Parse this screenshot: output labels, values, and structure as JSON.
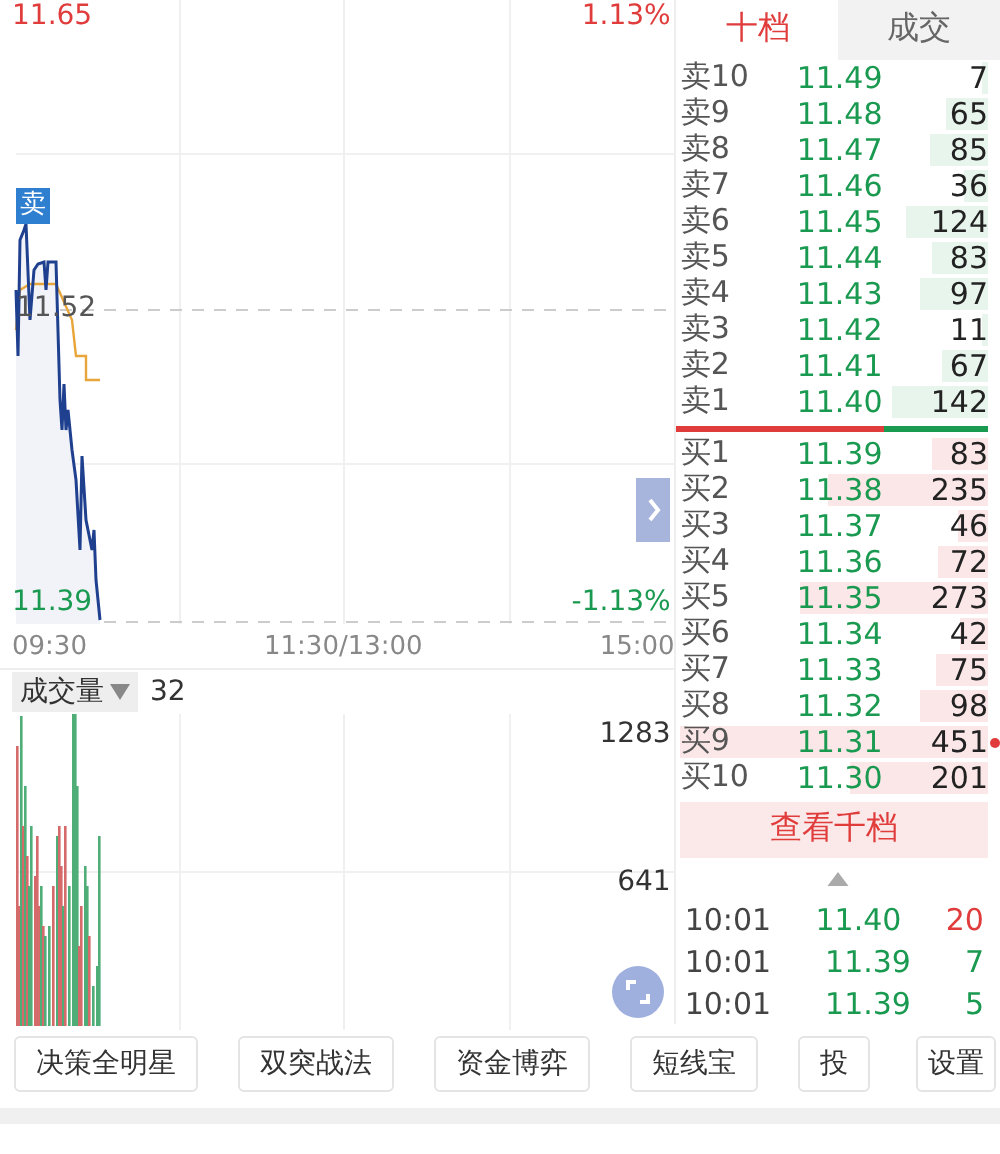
{
  "price_chart": {
    "high": "11.65",
    "high_pct": "1.13%",
    "mid": "11.52",
    "low": "11.39",
    "low_pct": "-1.13%",
    "signal_badge": "卖",
    "times": [
      "09:30",
      "11:30/13:00",
      "15:00"
    ]
  },
  "volume_chart": {
    "indicator": "成交量",
    "value": "32",
    "axis_labels": [
      "1283",
      "641"
    ]
  },
  "tabs": [
    {
      "label": "十档",
      "selected": true
    },
    {
      "label": "成交",
      "selected": false
    }
  ],
  "asks": [
    {
      "label": "卖10",
      "price": "11.49",
      "volume": "7",
      "level": 0.02
    },
    {
      "label": "卖9",
      "price": "11.48",
      "volume": "65",
      "level": 0.14
    },
    {
      "label": "卖8",
      "price": "11.47",
      "volume": "85",
      "level": 0.19
    },
    {
      "label": "卖7",
      "price": "11.46",
      "volume": "36",
      "level": 0.08
    },
    {
      "label": "卖6",
      "price": "11.45",
      "volume": "124",
      "level": 0.27
    },
    {
      "label": "卖5",
      "price": "11.44",
      "volume": "83",
      "level": 0.18
    },
    {
      "label": "卖4",
      "price": "11.43",
      "volume": "97",
      "level": 0.22
    },
    {
      "label": "卖3",
      "price": "11.42",
      "volume": "11",
      "level": 0.02
    },
    {
      "label": "卖2",
      "price": "11.41",
      "volume": "67",
      "level": 0.15
    },
    {
      "label": "卖1",
      "price": "11.40",
      "volume": "142",
      "level": 0.31
    }
  ],
  "bids": [
    {
      "label": "买1",
      "price": "11.39",
      "volume": "83",
      "level": 0.18,
      "marked": false
    },
    {
      "label": "买2",
      "price": "11.38",
      "volume": "235",
      "level": 0.52,
      "marked": false
    },
    {
      "label": "买3",
      "price": "11.37",
      "volume": "46",
      "level": 0.1,
      "marked": false
    },
    {
      "label": "买4",
      "price": "11.36",
      "volume": "72",
      "level": 0.16,
      "marked": false
    },
    {
      "label": "买5",
      "price": "11.35",
      "volume": "273",
      "level": 0.61,
      "marked": false
    },
    {
      "label": "买6",
      "price": "11.34",
      "volume": "42",
      "level": 0.09,
      "marked": false
    },
    {
      "label": "买7",
      "price": "11.33",
      "volume": "75",
      "level": 0.17,
      "marked": false
    },
    {
      "label": "买8",
      "price": "11.32",
      "volume": "98",
      "level": 0.22,
      "marked": false
    },
    {
      "label": "买9",
      "price": "11.31",
      "volume": "451",
      "level": 1,
      "marked": true
    },
    {
      "label": "买10",
      "price": "11.30",
      "volume": "201",
      "level": 0.45,
      "marked": false
    }
  ],
  "more_button": "查看千档",
  "trades": [
    {
      "time": "10:01",
      "price": "11.40",
      "volume": "20",
      "color": "#e03c3c"
    },
    {
      "time": "10:01",
      "price": "11.39",
      "volume": "7",
      "color": "#1a9a50"
    },
    {
      "time": "10:01",
      "price": "11.39",
      "volume": "5",
      "color": "#1a9a50"
    }
  ],
  "tools": [
    "决策全明星",
    "双突战法",
    "资金博弈",
    "短线宝",
    "投"
  ],
  "settings_button": "设置"
}
